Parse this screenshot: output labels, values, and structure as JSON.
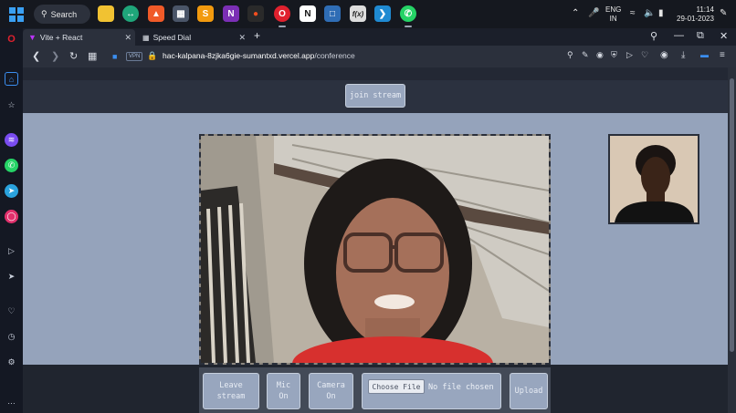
{
  "taskbar": {
    "search_label": "Search",
    "apps": [
      "file-explorer-icon",
      "network-icon",
      "brave-icon",
      "calculator-icon",
      "sublime-icon",
      "onenote-icon",
      "figma-icon",
      "opera-icon",
      "notion-icon",
      "virtualbox-icon",
      "geogebra-icon",
      "vscode-icon",
      "whatsapp-icon"
    ],
    "lang_line1": "ENG",
    "lang_line2": "IN",
    "time": "11:14",
    "date": "29-01-2023"
  },
  "browser": {
    "tabs": [
      {
        "label": "Vite + React",
        "active": true
      },
      {
        "label": "Speed Dial",
        "active": false
      }
    ],
    "new_tab": "+",
    "url_host": "hac-kalpana-8zjka6gie-sumantxd.vercel.app",
    "url_path": "/conference",
    "vpn_badge": "VPN"
  },
  "page": {
    "join_stream": "join stream",
    "controls": {
      "leave_line1": "Leave",
      "leave_line2": "stream",
      "mic_line1": "Mic",
      "mic_line2": "On",
      "camera_line1": "Camera",
      "camera_line2": "On",
      "choose_file": "Choose File",
      "file_status": "No file chosen",
      "upload": "Upload"
    }
  },
  "colors": {
    "page_body": "#95a3bb",
    "header": "#2b313f",
    "button": "#98a6be",
    "accent_opera": "#e0212e"
  }
}
